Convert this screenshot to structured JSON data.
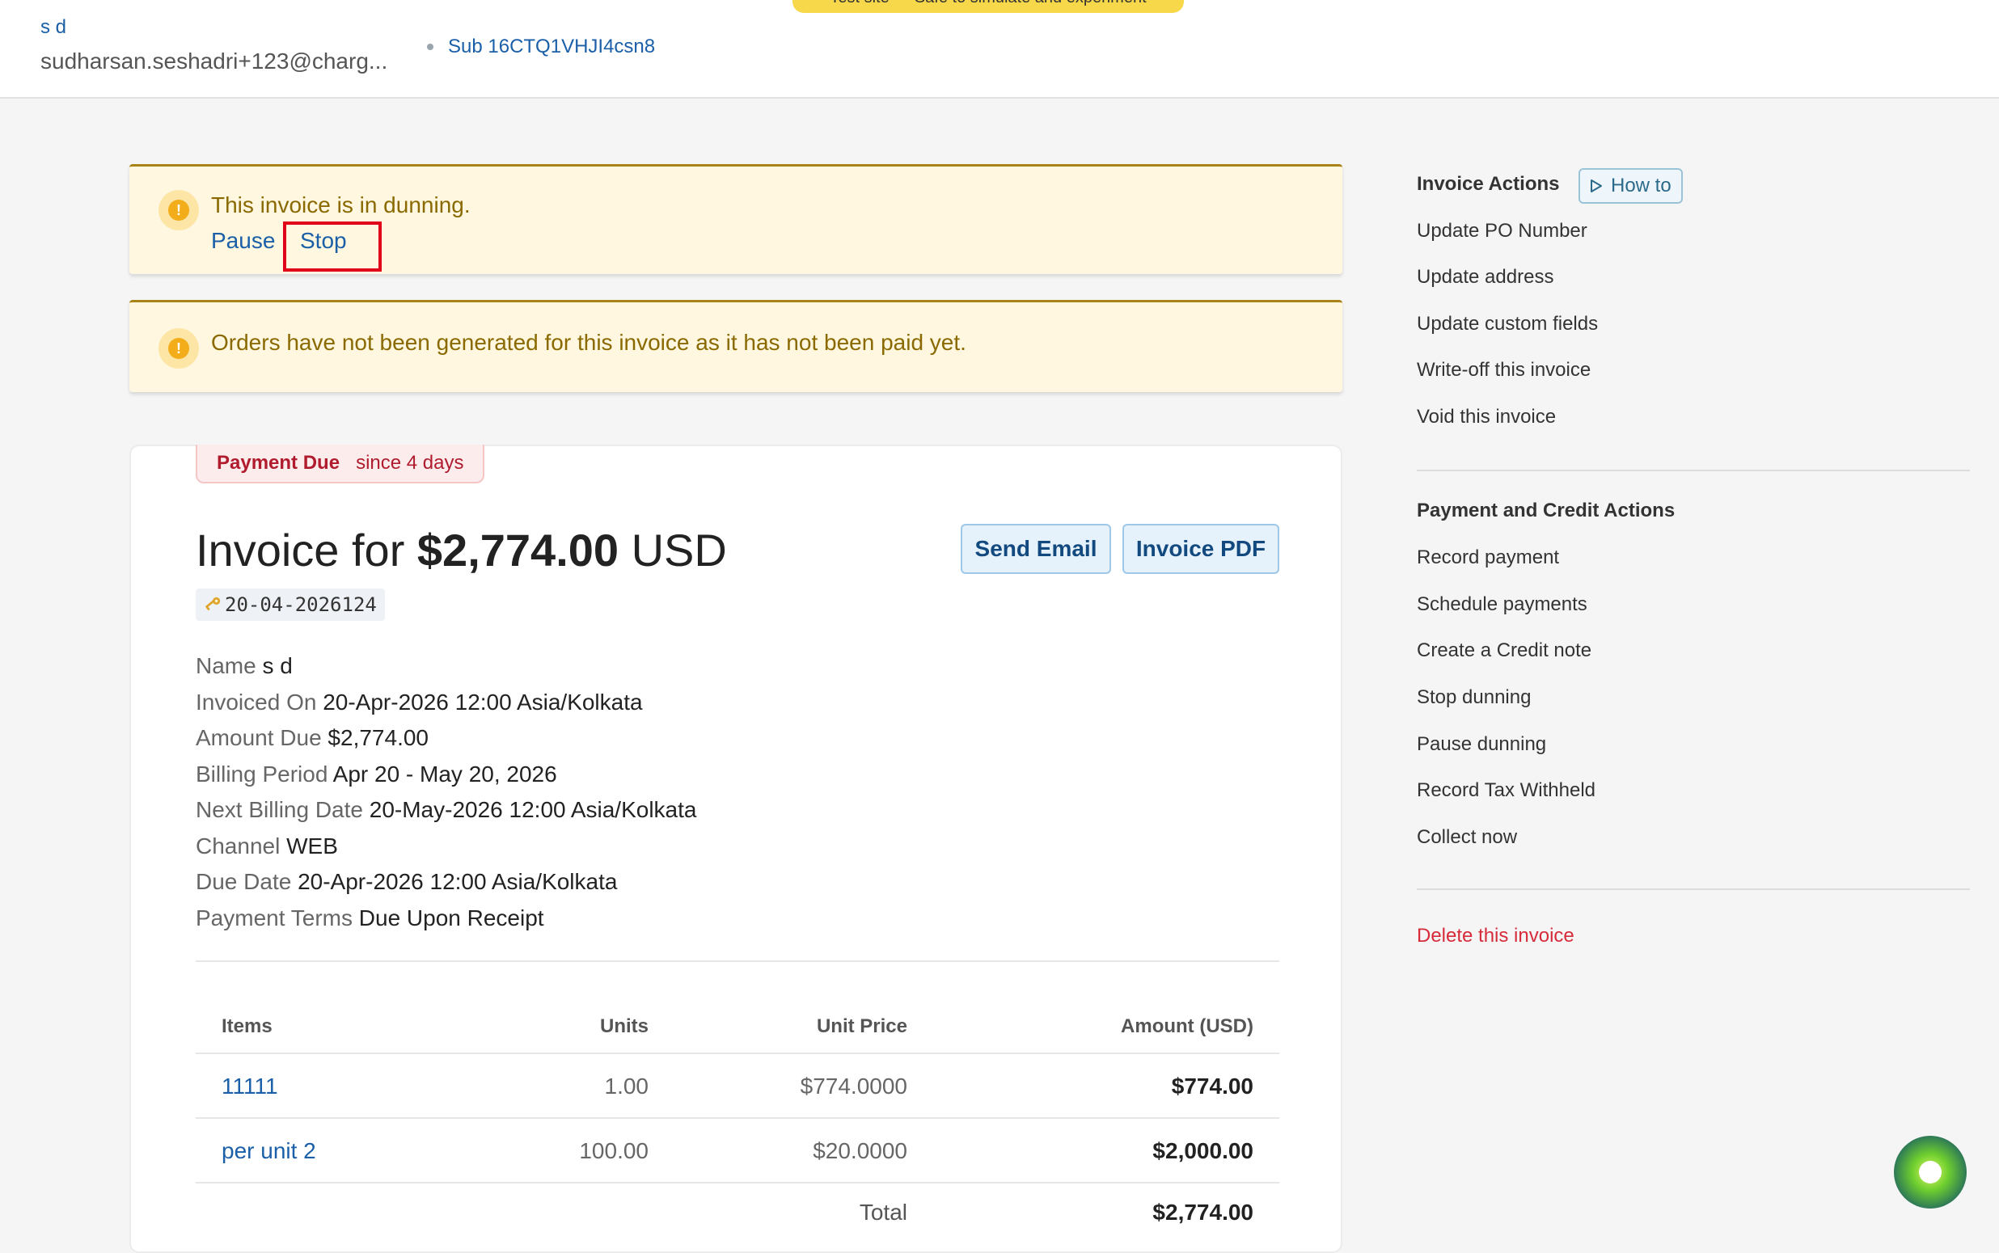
{
  "header": {
    "customer_name": "s d",
    "customer_email": "sudharsan.seshadri+123@charg...",
    "subscription_link": "Sub 16CTQ1VHJI4csn8",
    "test_banner": "Test site — Safe to simulate and experiment"
  },
  "alerts": {
    "dunning_message": "This invoice is in dunning.",
    "pause_label": "Pause",
    "stop_label": "Stop",
    "orders_message": "Orders have not been generated for this invoice as it has not been paid yet."
  },
  "invoice": {
    "status_label": "Payment Due",
    "status_since": "since 4 days",
    "title_prefix": "Invoice for",
    "amount": "$2,774.00",
    "currency": "USD",
    "send_email_label": "Send Email",
    "invoice_pdf_label": "Invoice PDF",
    "number": "20-04-2026124",
    "details": [
      {
        "key": "Name",
        "value": "s d"
      },
      {
        "key": "Invoiced On",
        "value": "20-Apr-2026 12:00 Asia/Kolkata"
      },
      {
        "key": "Amount Due",
        "value": "$2,774.00"
      },
      {
        "key": "Billing Period",
        "value": "Apr 20 - May 20, 2026"
      },
      {
        "key": "Next Billing Date",
        "value": "20-May-2026 12:00 Asia/Kolkata"
      },
      {
        "key": "Channel",
        "value": "WEB"
      },
      {
        "key": "Due Date",
        "value": "20-Apr-2026 12:00 Asia/Kolkata"
      },
      {
        "key": "Payment Terms",
        "value": "Due Upon Receipt"
      }
    ],
    "table": {
      "headers": {
        "items": "Items",
        "units": "Units",
        "unit_price": "Unit Price",
        "amount": "Amount (USD)"
      },
      "rows": [
        {
          "item": "11111",
          "units": "1.00",
          "unit_price": "$774.0000",
          "amount": "$774.00"
        },
        {
          "item": "per unit 2",
          "units": "100.00",
          "unit_price": "$20.0000",
          "amount": "$2,000.00"
        }
      ],
      "total_label": "Total",
      "total_amount": "$2,774.00"
    }
  },
  "sidebar": {
    "invoice_actions_heading": "Invoice Actions",
    "how_to_label": "How to",
    "invoice_actions": [
      "Update PO Number",
      "Update address",
      "Update custom fields",
      "Write-off this invoice",
      "Void this invoice"
    ],
    "payment_actions_heading": "Payment and Credit Actions",
    "payment_actions": [
      "Record payment",
      "Schedule payments",
      "Create a Credit note",
      "Stop dunning",
      "Pause dunning",
      "Record Tax Withheld",
      "Collect now"
    ],
    "delete_label": "Delete this invoice"
  },
  "colors": {
    "link": "#1a5fa8",
    "warning_bg": "#fff7df",
    "warning_text": "#8a6a00",
    "danger": "#d62b3a",
    "highlight": "#e0001a"
  }
}
